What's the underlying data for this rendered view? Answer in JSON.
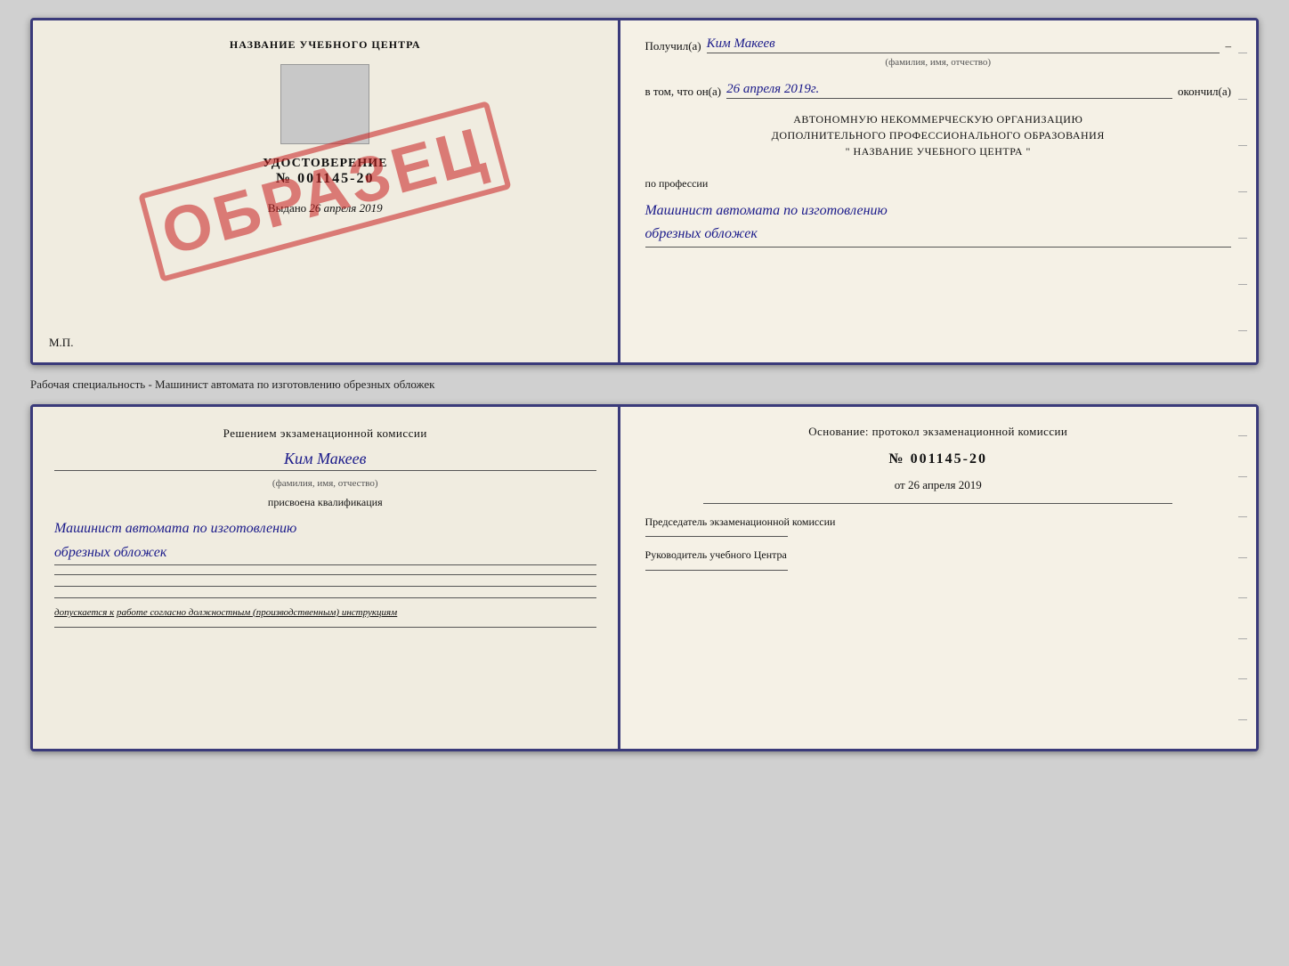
{
  "top_cert": {
    "left": {
      "title": "НАЗВАНИЕ УЧЕБНОГО ЦЕНТРА",
      "udost_label": "УДОСТОВЕРЕНИЕ",
      "number": "№ 001145-20",
      "vydano_prefix": "Выдано",
      "vydano_date": "26 апреля 2019",
      "mp": "М.П.",
      "stamp": "ОБРАЗЕЦ"
    },
    "right": {
      "poluchil_prefix": "Получил(а)",
      "poluchil_name": "Ким Макеев",
      "fio_label": "(фамилия, имя, отчество)",
      "vtom_prefix": "в том, что он(а)",
      "vtom_date": "26 апреля 2019г.",
      "okonchil": "окончил(а)",
      "org_line1": "АВТОНОМНУЮ НЕКОММЕРЧЕСКУЮ ОРГАНИЗАЦИЮ",
      "org_line2": "ДОПОЛНИТЕЛЬНОГО ПРОФЕССИОНАЛЬНОГО ОБРАЗОВАНИЯ",
      "org_line3": "\"   НАЗВАНИЕ УЧЕБНОГО ЦЕНТРА   \"",
      "po_professii": "по профессии",
      "profession_line1": "Машинист автомата по изготовлению",
      "profession_line2": "обрезных обложек"
    }
  },
  "separator": {
    "text": "Рабочая специальность - Машинист автомата по изготовлению обрезных обложек"
  },
  "bottom_insert": {
    "left": {
      "heading": "Решением экзаменационной комиссии",
      "name": "Ким Макеев",
      "fio_label": "(фамилия, имя, отчество)",
      "prisvoena": "присвоена квалификация",
      "qualification_line1": "Машинист автомата по изготовлению",
      "qualification_line2": "обрезных обложек",
      "dopusk_prefix": "допускается к",
      "dopusk_text": "работе согласно должностным (производственным) инструкциям"
    },
    "right": {
      "osnovanie": "Основание: протокол экзаменационной комиссии",
      "number": "№ 001145-20",
      "ot_prefix": "от",
      "date": "26 апреля 2019",
      "chairman_label": "Председатель экзаменационной комиссии",
      "rukovoditel_label": "Руководитель учебного Центра"
    }
  }
}
